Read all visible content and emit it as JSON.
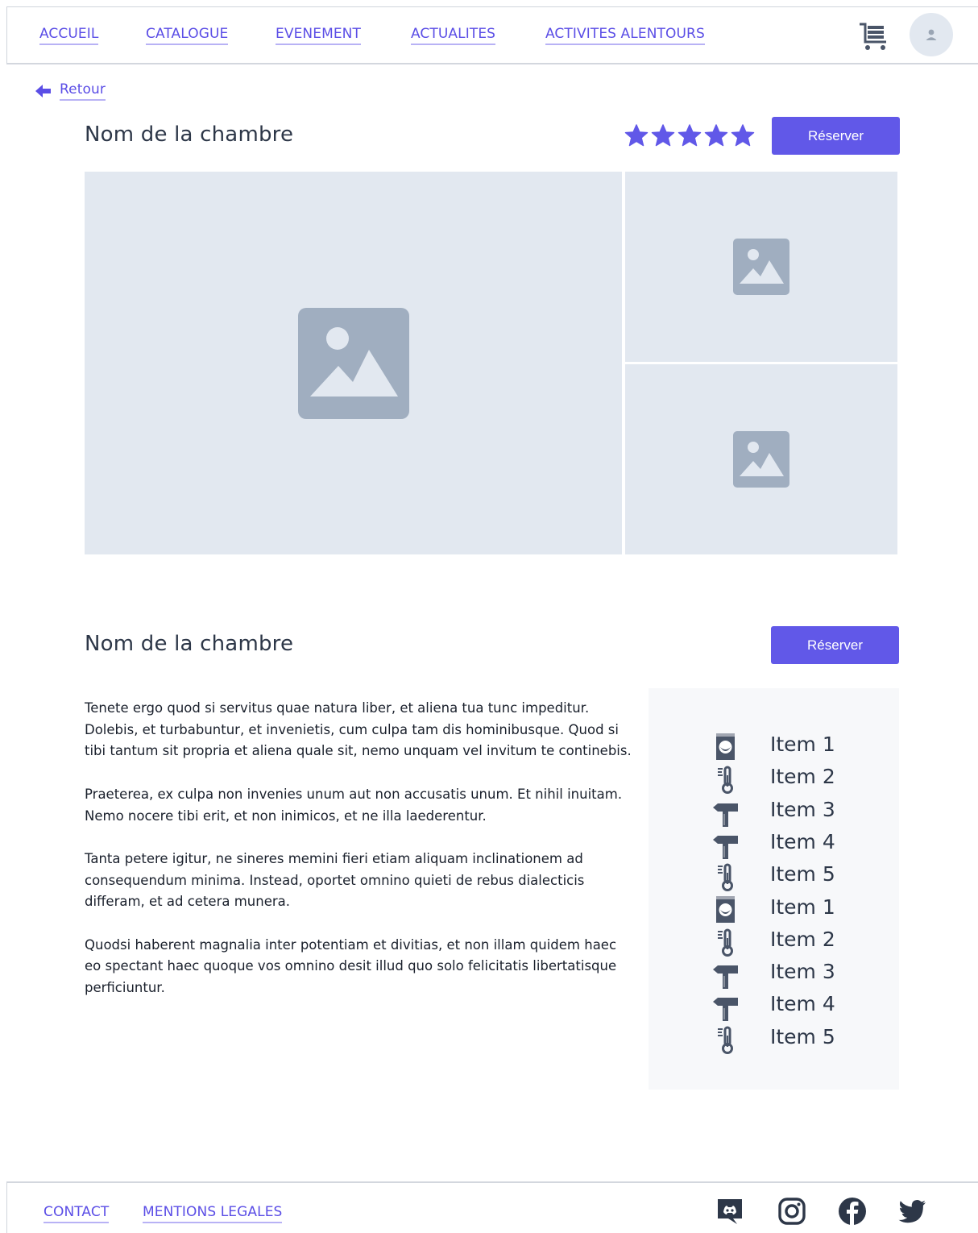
{
  "nav": {
    "items": [
      {
        "label": "ACCUEIL"
      },
      {
        "label": "CATALOGUE"
      },
      {
        "label": "EVENEMENT"
      },
      {
        "label": "ACTUALITES"
      },
      {
        "label": "ACTIVITES ALENTOURS"
      }
    ],
    "cart_icon": "cart-icon",
    "avatar_icon": "user-icon"
  },
  "back": {
    "label": "Retour"
  },
  "header": {
    "title": "Nom de la chambre",
    "rating": 5,
    "rating_max": 5,
    "reserve_label": "Réserver"
  },
  "detail": {
    "title": "Nom de la chambre",
    "reserve_label": "Réserver",
    "paragraphs": [
      "Tenete ergo quod si servitus quae natura liber, et aliena tua tunc impeditur. Dolebis, et turbabuntur, et invenietis, cum culpa tam dis hominibusque. Quod si tibi tantum sit propria et aliena quale sit, nemo unquam vel invitum te continebis.",
      "Praeterea, ex culpa non invenies unum aut non accusatis unum. Et nihil inuitam. Nemo nocere tibi erit, et non inimicos, et ne illa laederentur.",
      "Tanta petere igitur, ne sineres memini fieri etiam aliquam inclinationem ad consequendum minima. Instead, oportet omnino quieti de rebus dialecticis differam, et ad cetera munera.",
      "Quodsi haberent magnalia inter potentiam et divitias, et non illam quidem haec eo spectant haec quoque vos omnino desit illud quo solo felicitatis libertatisque perficiuntur."
    ]
  },
  "amenities": [
    {
      "label": "Item 1",
      "icon": "washing-machine-icon"
    },
    {
      "label": "Item 2",
      "icon": "thermometer-icon"
    },
    {
      "label": "Item 3",
      "icon": "signpost-icon"
    },
    {
      "label": "Item 4",
      "icon": "signpost-icon"
    },
    {
      "label": "Item 5",
      "icon": "thermometer-icon"
    },
    {
      "label": "Item 1",
      "icon": "washing-machine-icon"
    },
    {
      "label": "Item 2",
      "icon": "thermometer-icon"
    },
    {
      "label": "Item 3",
      "icon": "signpost-icon"
    },
    {
      "label": "Item 4",
      "icon": "signpost-icon"
    },
    {
      "label": "Item 5",
      "icon": "thermometer-icon"
    }
  ],
  "footer": {
    "links": [
      {
        "label": "CONTACT"
      },
      {
        "label": "MENTIONS LEGALES"
      }
    ],
    "social": [
      "discord-icon",
      "instagram-icon",
      "facebook-icon",
      "twitter-icon"
    ]
  },
  "colors": {
    "accent": "#6158e8",
    "link": "#5b4ee6",
    "placeholder_bg": "#e2e8f0",
    "placeholder_icon": "#a0aec0",
    "amenity_icon": "#4a5568",
    "social_icon": "#2d3748"
  }
}
